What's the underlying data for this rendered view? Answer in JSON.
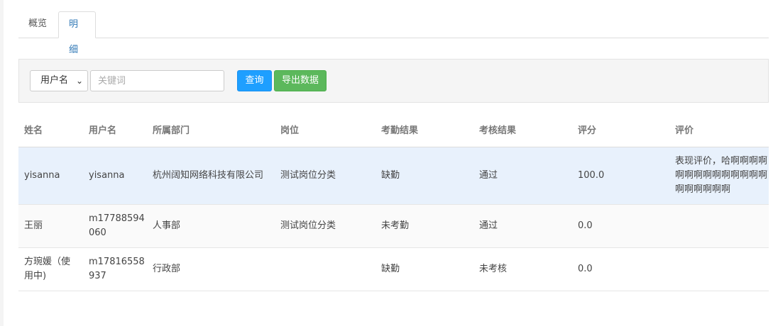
{
  "tabs": [
    {
      "label": "概览",
      "active": false
    },
    {
      "label": "明细",
      "active": true
    }
  ],
  "filter": {
    "field_select": {
      "selected": "用户名",
      "options": [
        "用户名"
      ]
    },
    "keyword_placeholder": "关键词",
    "keyword_value": "",
    "query_label": "查询",
    "export_label": "导出数据"
  },
  "table": {
    "headers": [
      "姓名",
      "用户名",
      "所属部门",
      "岗位",
      "考勤结果",
      "考核结果",
      "评分",
      "评价"
    ],
    "rows": [
      {
        "name": "yisanna",
        "username": "yisanna",
        "department": "杭州阔知网络科技有限公司",
        "position": "测试岗位分类",
        "attendance": "缺勤",
        "assessment": "通过",
        "score": "100.0",
        "evaluation": "表现评价，哈啊啊啊啊啊啊啊啊啊啊啊啊啊啊啊啊啊啊啊啊"
      },
      {
        "name": "王丽",
        "username": "m17788594060",
        "department": "人事部",
        "position": "测试岗位分类",
        "attendance": "未考勤",
        "assessment": "通过",
        "score": "0.0",
        "evaluation": ""
      },
      {
        "name": "方琬媛（使用中)",
        "username": "m17816558937",
        "department": "行政部",
        "position": "",
        "attendance": "缺勤",
        "assessment": "未考核",
        "score": "0.0",
        "evaluation": ""
      }
    ]
  },
  "colors": {
    "active_tab": "#337ab7",
    "query_button": "#1e9fff",
    "export_button": "#5cb85c",
    "highlight_row": "#e8f1fc"
  }
}
